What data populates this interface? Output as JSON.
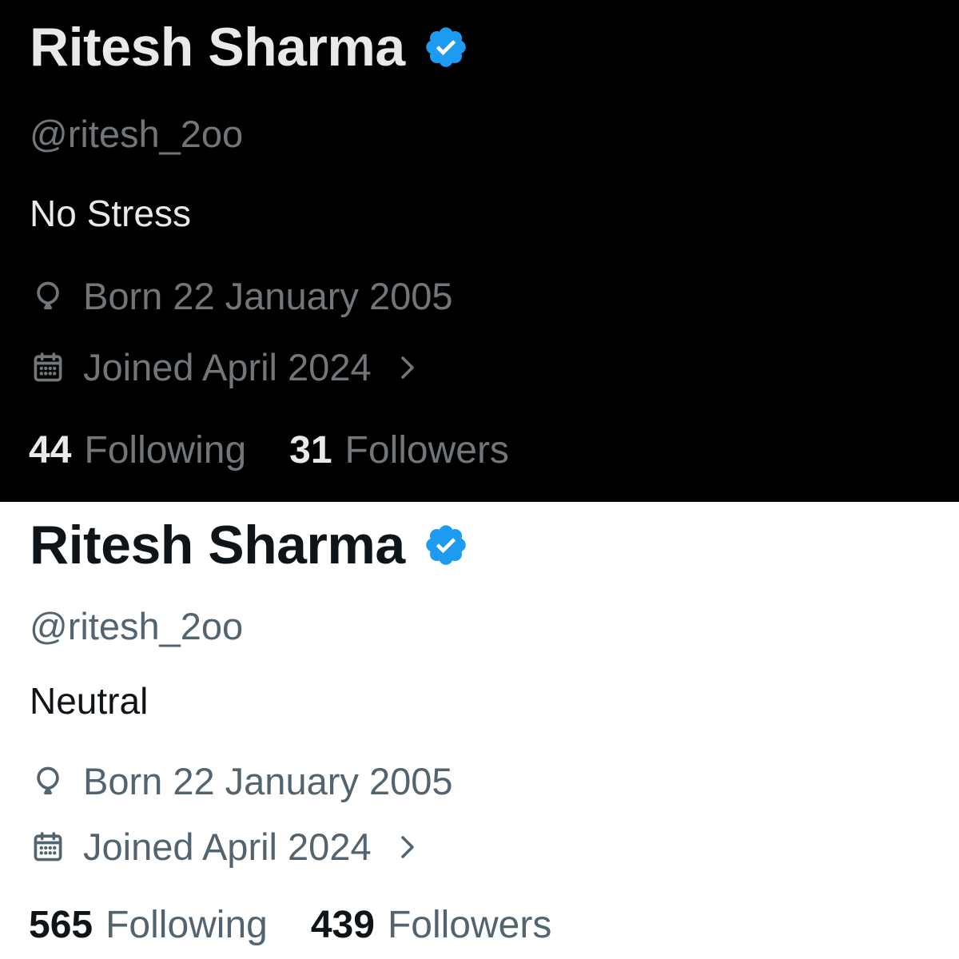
{
  "accent_color": "#1d9bf0",
  "profiles": [
    {
      "theme": "dark",
      "display_name": "Ritesh Sharma",
      "verified_icon": "verified-badge-icon",
      "handle": "@ritesh_2oo",
      "bio": "No Stress",
      "birthday": {
        "icon": "balloon-icon",
        "text": "Born 22 January 2005"
      },
      "joined": {
        "icon": "calendar-icon",
        "text": "Joined April 2024"
      },
      "following": {
        "count": "44",
        "label": "Following"
      },
      "followers": {
        "count": "31",
        "label": "Followers"
      }
    },
    {
      "theme": "light",
      "display_name": "Ritesh Sharma",
      "verified_icon": "verified-badge-icon",
      "handle": "@ritesh_2oo",
      "bio": "Neutral",
      "birthday": {
        "icon": "balloon-icon",
        "text": "Born 22 January 2005"
      },
      "joined": {
        "icon": "calendar-icon",
        "text": "Joined April 2024"
      },
      "following": {
        "count": "565",
        "label": "Following"
      },
      "followers": {
        "count": "439",
        "label": "Followers"
      }
    }
  ]
}
